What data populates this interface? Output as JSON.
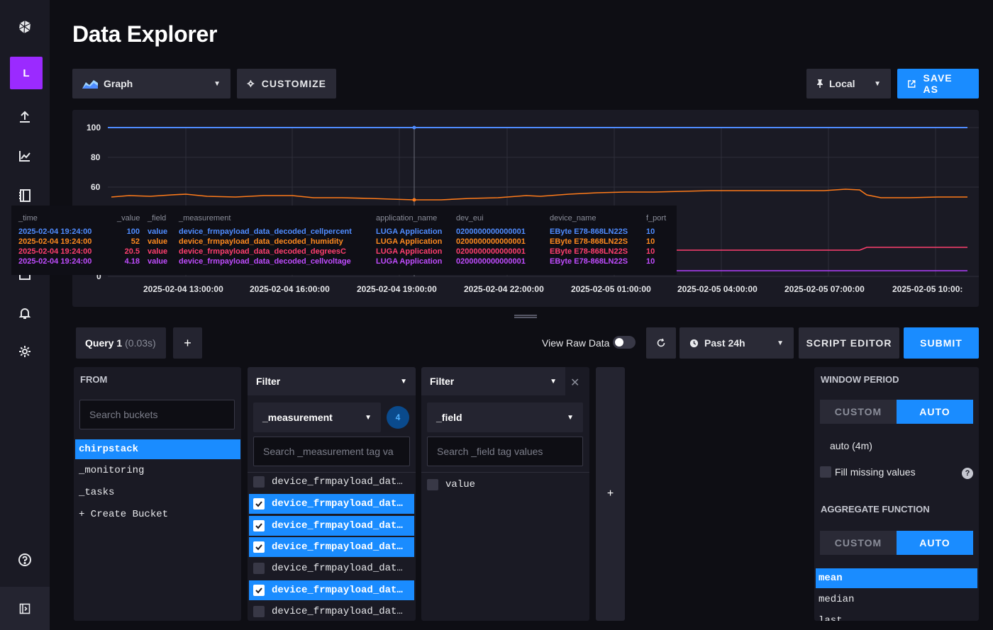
{
  "page": {
    "title": "Data Explorer"
  },
  "sidebar": {
    "org_initial": "L",
    "icons": [
      "influx-logo-icon",
      "upload-icon",
      "chart-icon",
      "notebook-icon",
      "dashboard-icon",
      "bell-icon",
      "gear-icon",
      "help-icon",
      "collapse-sidebar-icon"
    ]
  },
  "toolbar": {
    "graph_label": "Graph",
    "customize_label": "CUSTOMIZE",
    "timezone_label": "Local",
    "save_as_label": "SAVE AS"
  },
  "graph": {
    "y_ticks": [
      "100",
      "80",
      "60",
      "0"
    ],
    "x_ticks": [
      "2025-02-04 13:00:00",
      "2025-02-04 16:00:00",
      "2025-02-04 19:00:00",
      "2025-02-04 22:00:00",
      "2025-02-05 01:00:00",
      "2025-02-05 04:00:00",
      "2025-02-05 07:00:00",
      "2025-02-05 10:00:"
    ],
    "colors": {
      "cellpercent": "#4f8cff",
      "humidity": "#ff7b1a",
      "degreesC": "#ff3f6e",
      "cellvoltage": "#b23fff"
    }
  },
  "tooltip": {
    "headers": [
      "_time",
      "_value",
      "_field",
      "_measurement",
      "application_name",
      "dev_eui",
      "device_name",
      "f_port"
    ],
    "rows": [
      {
        "time": "2025-02-04 19:24:00",
        "value": "100",
        "field": "value",
        "measurement": "device_frmpayload_data_decoded_cellpercent",
        "app": "LUGA Application",
        "eui": "0200000000000001",
        "device": "EByte E78-868LN22S",
        "port": "10",
        "color": "#4f8cff"
      },
      {
        "time": "2025-02-04 19:24:00",
        "value": "52",
        "field": "value",
        "measurement": "device_frmpayload_data_decoded_humidity",
        "app": "LUGA Application",
        "eui": "0200000000000001",
        "device": "EByte E78-868LN22S",
        "port": "10",
        "color": "#ff8a1f"
      },
      {
        "time": "2025-02-04 19:24:00",
        "value": "20.5",
        "field": "value",
        "measurement": "device_frmpayload_data_decoded_degreesC",
        "app": "LUGA Application",
        "eui": "0200000000000001",
        "device": "EByte E78-868LN22S",
        "port": "10",
        "color": "#ff3f6e"
      },
      {
        "time": "2025-02-04 19:24:00",
        "value": "4.18",
        "field": "value",
        "measurement": "device_frmpayload_data_decoded_cellvoltage",
        "app": "LUGA Application",
        "eui": "0200000000000001",
        "device": "EByte E78-868LN22S",
        "port": "10",
        "color": "#c04cff"
      }
    ]
  },
  "query": {
    "tab_label": "Query 1",
    "tab_time": "(0.03s)",
    "add_label": "+",
    "view_raw_label": "View Raw Data",
    "time_range": "Past 24h",
    "script_editor_label": "SCRIPT EDITOR",
    "submit_label": "SUBMIT"
  },
  "from": {
    "title": "FROM",
    "search_placeholder": "Search buckets",
    "buckets": [
      {
        "label": "chirpstack",
        "selected": true
      },
      {
        "label": "_monitoring",
        "selected": false
      },
      {
        "label": "_tasks",
        "selected": false
      },
      {
        "label": "+ Create Bucket",
        "selected": false
      }
    ]
  },
  "filter1": {
    "header": "Filter",
    "key": "_measurement",
    "count": "4",
    "search_placeholder": "Search _measurement tag va",
    "items": [
      {
        "label": "device_frmpayload_dat…",
        "checked": false
      },
      {
        "label": "device_frmpayload_dat…",
        "checked": true
      },
      {
        "label": "device_frmpayload_dat…",
        "checked": true
      },
      {
        "label": "device_frmpayload_dat…",
        "checked": true
      },
      {
        "label": "device_frmpayload_dat…",
        "checked": false
      },
      {
        "label": "device_frmpayload_dat…",
        "checked": true
      },
      {
        "label": "device_frmpayload_dat…",
        "checked": false
      }
    ]
  },
  "filter2": {
    "header": "Filter",
    "close": "✕",
    "key": "_field",
    "search_placeholder": "Search _field tag values",
    "items": [
      {
        "label": "value",
        "checked": false
      }
    ]
  },
  "add_filter_label": "+",
  "window": {
    "title": "WINDOW PERIOD",
    "custom_label": "CUSTOM",
    "auto_label": "AUTO",
    "auto_value": "auto (4m)",
    "fill_missing_label": "Fill missing values",
    "help": "?"
  },
  "aggregate": {
    "title": "AGGREGATE FUNCTION",
    "custom_label": "CUSTOM",
    "auto_label": "AUTO",
    "functions": [
      {
        "label": "mean",
        "selected": true
      },
      {
        "label": "median",
        "selected": false
      },
      {
        "label": "last",
        "selected": false
      }
    ]
  }
}
